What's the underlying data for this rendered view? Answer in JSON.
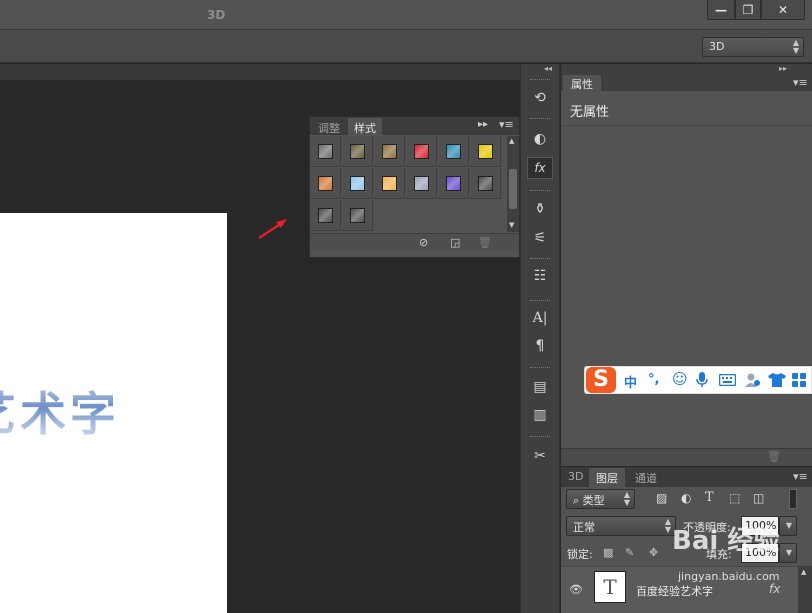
{
  "window": {
    "buttons": [
      "—",
      "❐",
      "✕"
    ]
  },
  "options_bar": {
    "mode_label": "3D",
    "mode_select": "3D"
  },
  "canvas": {
    "art_text": "艺术字"
  },
  "styles_panel": {
    "tabs": [
      "调整",
      "样式"
    ],
    "active_tab": "样式",
    "swatch_colors": [
      "#6d6d6d",
      "#6a5a3c",
      "#8b6d3d",
      "#d3252d",
      "#2d8ab0",
      "#e5c400",
      "#d0783a",
      "#8ec2ea",
      "#f1b14c",
      "#9aa4b6",
      "#6a4bd0",
      "#4e4e4e",
      "#4e4e4e",
      "#4e4e4e"
    ]
  },
  "properties_panel": {
    "tab": "属性",
    "empty_text": "无属性"
  },
  "ime_bar": {
    "logo": "S",
    "items": [
      "中",
      "°,",
      "☺",
      "🎤",
      "⌨",
      "👤",
      "👕",
      "▦"
    ]
  },
  "layers_panel": {
    "tabs": [
      "3D",
      "图层",
      "通道"
    ],
    "active_tab": "图层",
    "filter_type": "类型",
    "blend_mode": "正常",
    "opacity_label": "不透明度:",
    "opacity_value": "100%",
    "lock_label": "锁定:",
    "fill_label": "填充:",
    "fill_value": "100%",
    "layer": {
      "thumb": "T",
      "name": "百度经验艺术字",
      "fx": "fx"
    }
  },
  "watermark": {
    "brand": "Bai 经验",
    "url": "jingyan.baidu.com"
  }
}
